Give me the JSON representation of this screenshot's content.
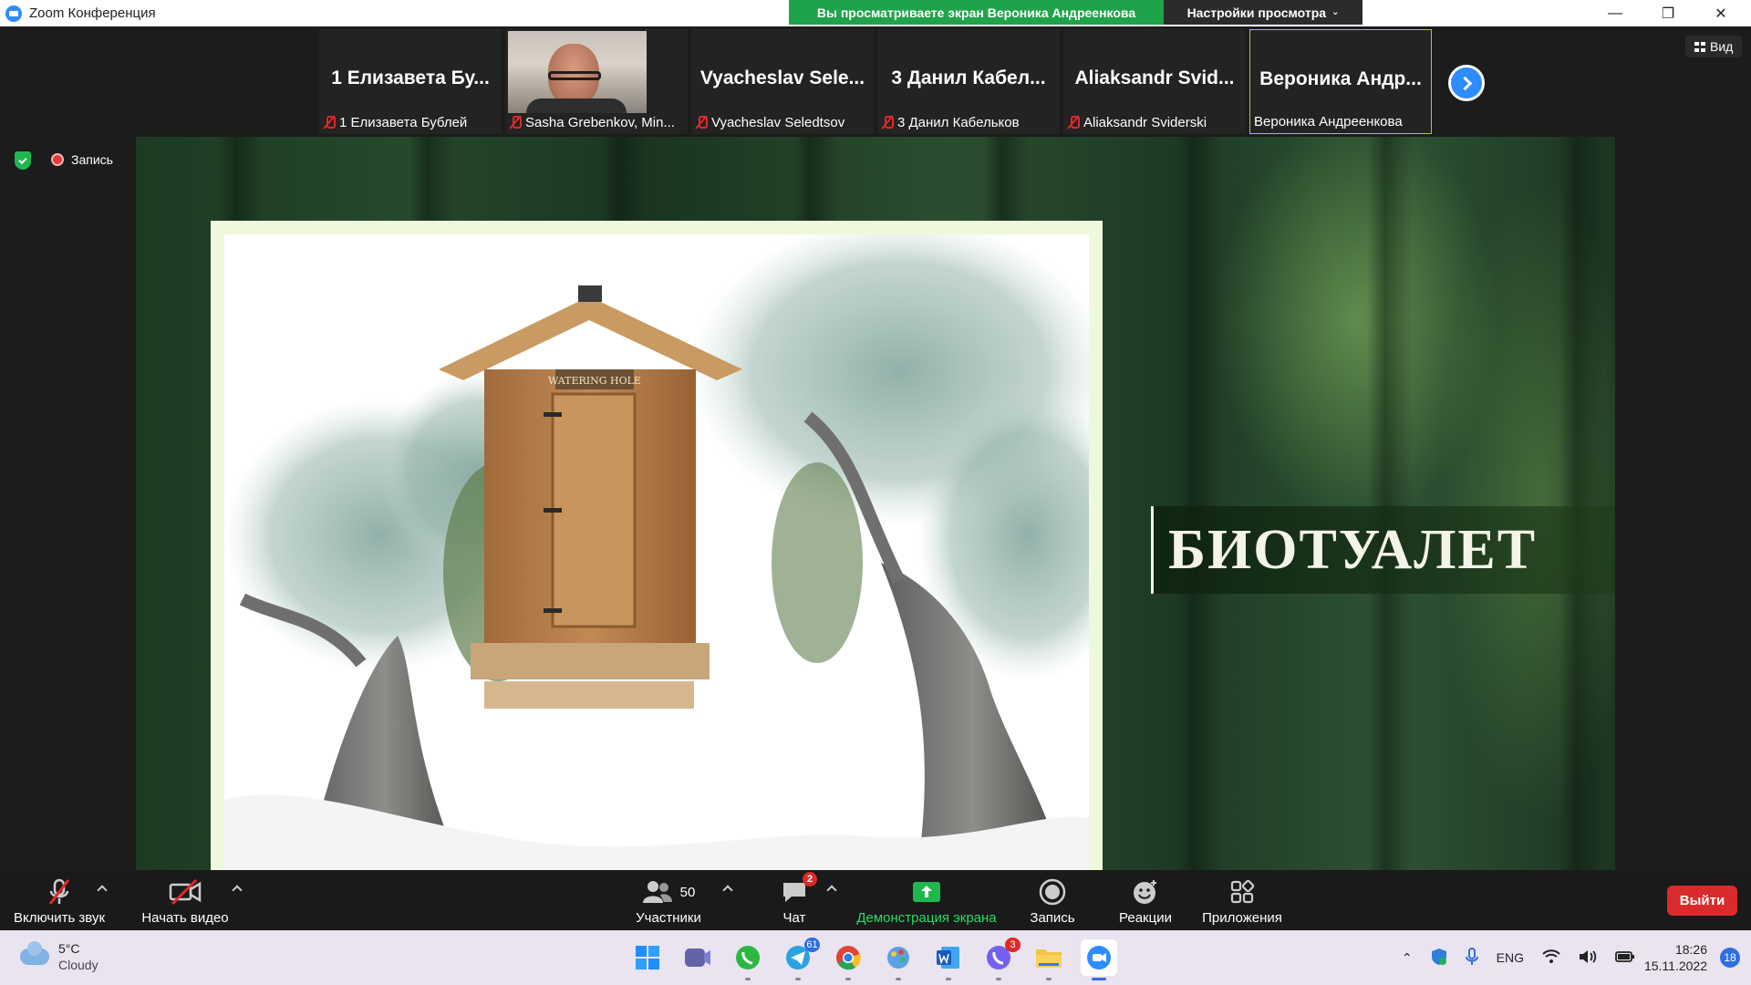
{
  "window": {
    "title": "Zoom Конференция",
    "share_banner": "Вы просматриваете экран Вероника Андреенкова",
    "view_settings": "Настройки просмотра",
    "controls": [
      "—",
      "❐",
      "✕"
    ]
  },
  "participants": [
    {
      "display": "1 Елизавета Бу...",
      "label": "1 Елизавета Бублей",
      "video": false,
      "active": false
    },
    {
      "display": "",
      "label": "Sasha Grebenkov, Min...",
      "video": true,
      "active": false
    },
    {
      "display": "Vyacheslav Sele...",
      "label": "Vyacheslav Seledtsov",
      "video": false,
      "active": false
    },
    {
      "display": "3 Данил Кабел...",
      "label": "3 Данил Кабельков",
      "video": false,
      "active": false
    },
    {
      "display": "Aliaksandr Svid...",
      "label": "Aliaksandr Sviderski",
      "video": false,
      "active": false
    },
    {
      "display": "Вероника Андр...",
      "label": "Вероника Андреенкова",
      "video": false,
      "active": true
    }
  ],
  "view_button": "Вид",
  "recording_label": "Запись",
  "slide": {
    "title": "БИОТУАЛЕТ",
    "sign_text": "WATERING HOLE"
  },
  "toolbar": {
    "unmute": "Включить звук",
    "start_video": "Начать видео",
    "participants": "Участники",
    "participants_count": "50",
    "chat": "Чат",
    "chat_badge": "2",
    "share_screen": "Демонстрация экрана",
    "record": "Запись",
    "reactions": "Реакции",
    "apps": "Приложения",
    "leave": "Выйти"
  },
  "taskbar": {
    "temperature": "5°C",
    "condition": "Cloudy",
    "telegram_badge": "61",
    "viber_badge": "3",
    "language": "ENG",
    "time": "18:26",
    "date": "15.11.2022",
    "notifications": "18"
  },
  "colors": {
    "zoom_blue": "#2d8cff",
    "share_green": "#1fa34a",
    "leave_red": "#d92b2b",
    "active_border": "#b8c43a"
  }
}
